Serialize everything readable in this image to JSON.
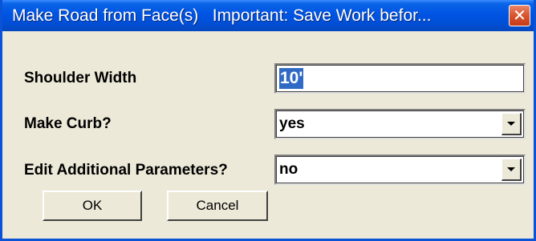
{
  "window": {
    "title": "Make Road from Face(s)   Important: Save Work befor...",
    "close_glyph": "✕"
  },
  "fields": {
    "shoulder_width": {
      "label": "Shoulder Width",
      "value": "10'"
    },
    "make_curb": {
      "label": "Make Curb?",
      "value": "yes"
    },
    "edit_params": {
      "label": "Edit Additional Parameters?",
      "value": "no"
    }
  },
  "buttons": {
    "ok": "OK",
    "cancel": "Cancel"
  },
  "colors": {
    "titlebar": "#0054e3",
    "window_bg": "#ece9d8",
    "selection": "#316ac5",
    "close_button": "#d9542d"
  }
}
